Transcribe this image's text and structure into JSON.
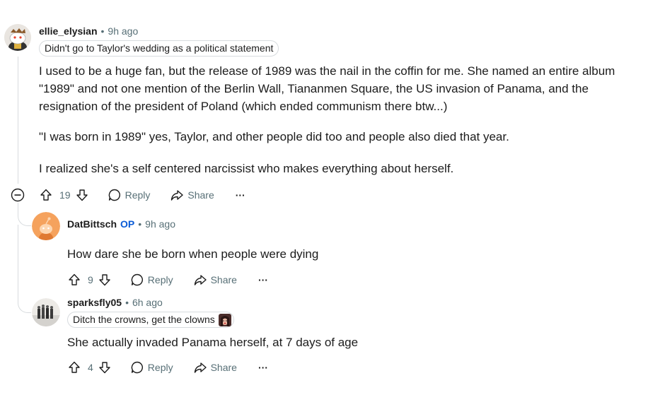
{
  "comments": [
    {
      "username": "ellie_elysian",
      "separator": "•",
      "time": "9h ago",
      "flair": "Didn't go to Taylor's wedding as a political statement",
      "paragraphs": [
        "I used to be a huge fan, but the release of 1989 was the nail in the coffin for me.  She named an entire album \"1989\" and not one mention of the Berlin Wall, Tiananmen Square, the US invasion of Panama, and the resignation of the president of Poland (which ended communism there btw...)",
        "\"I was born in 1989\" yes, Taylor, and other people did too and people also died that year.",
        "I realized she's a self centered narcissist who makes everything about herself."
      ],
      "votes": "19",
      "reply_label": "Reply",
      "share_label": "Share",
      "more_label": "···"
    },
    {
      "username": "DatBittsch",
      "op_badge": "OP",
      "separator": "•",
      "time": "9h ago",
      "text": "How dare she be born when people were dying",
      "votes": "9",
      "reply_label": "Reply",
      "share_label": "Share",
      "more_label": "···"
    },
    {
      "username": "sparksfly05",
      "separator": "•",
      "time": "6h ago",
      "flair": "Ditch the crowns, get the clowns",
      "text": "She actually invaded Panama herself, at 7 days of age",
      "votes": "4",
      "reply_label": "Reply",
      "share_label": "Share",
      "more_label": "···"
    }
  ],
  "icons": {
    "collapse": "collapse-thread-icon",
    "upvote": "upvote-arrow-icon",
    "downvote": "downvote-arrow-icon",
    "reply": "speech-bubble-icon",
    "share": "share-arrow-icon",
    "more": "more-options-icon"
  },
  "colors": {
    "meta_gray": "#576f76",
    "op_blue": "#0a5bd6",
    "thread_line": "#d7dbde",
    "avatar_orange": "#f5a25d"
  }
}
